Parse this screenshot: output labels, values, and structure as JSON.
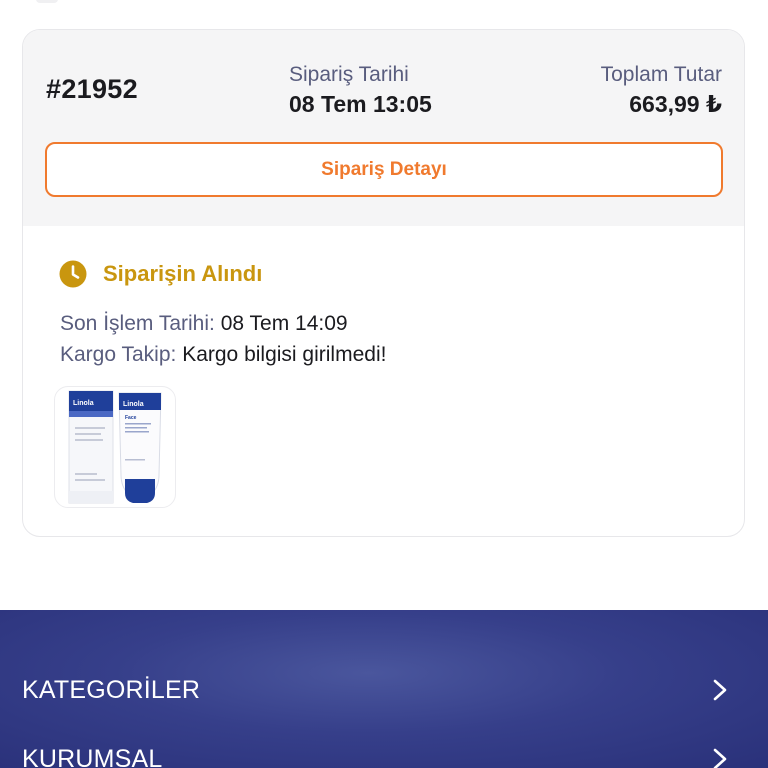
{
  "order": {
    "number": "#21952",
    "date_label": "Sipariş Tarihi",
    "date_value": "08 Tem 13:05",
    "total_label": "Toplam Tutar",
    "total_value": "663,99 ₺",
    "detail_button": "Sipariş Detayı"
  },
  "status": {
    "icon": "clock-icon",
    "text": "Siparişin Alındı",
    "color": "#c9960f",
    "last_action_label": "Son İşlem Tarihi:",
    "last_action_value": "08 Tem 14:09",
    "cargo_label": "Kargo Takip:",
    "cargo_value": "Kargo bilgisi girilmedi!"
  },
  "product": {
    "brand_text": "Linola",
    "variant_text": "Face"
  },
  "footer": {
    "items": [
      {
        "label": "KATEGORİLER",
        "icon": "chevron-right-icon"
      },
      {
        "label": "KURUMSAL",
        "icon": "chevron-right-icon"
      }
    ]
  },
  "colors": {
    "accent": "#f07a2e",
    "status": "#c9960f",
    "footer": "#363f8a",
    "label_text": "#595d7e"
  }
}
